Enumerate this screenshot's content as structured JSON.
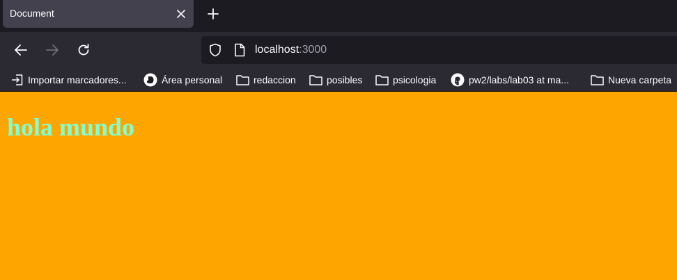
{
  "tab": {
    "title": "Document",
    "close_icon": "close-icon",
    "new_tab_icon": "plus-icon"
  },
  "nav": {
    "back_icon": "arrow-left-icon",
    "forward_icon": "arrow-right-icon",
    "reload_icon": "reload-icon",
    "url_host": "localhost",
    "url_port": ":3000"
  },
  "bookmarks": [
    {
      "label": "Importar marcadores...",
      "icon": "import-icon"
    },
    {
      "label": "Área personal",
      "icon": "d-logo-icon"
    },
    {
      "label": "redaccion",
      "icon": "folder-icon"
    },
    {
      "label": "posibles",
      "icon": "folder-icon"
    },
    {
      "label": "psicologia",
      "icon": "folder-icon"
    },
    {
      "label": "pw2/labs/lab03 at ma...",
      "icon": "github-icon"
    },
    {
      "label": "Nueva carpeta",
      "icon": "folder-icon"
    }
  ],
  "page": {
    "heading": "hola mundo",
    "background_color": "#ffa500",
    "heading_color": "#7fffd4"
  },
  "theme": {
    "tabstrip_bg": "#1c1b22",
    "toolbar_bg": "#2b2a33",
    "tab_active_bg": "#42414d"
  }
}
